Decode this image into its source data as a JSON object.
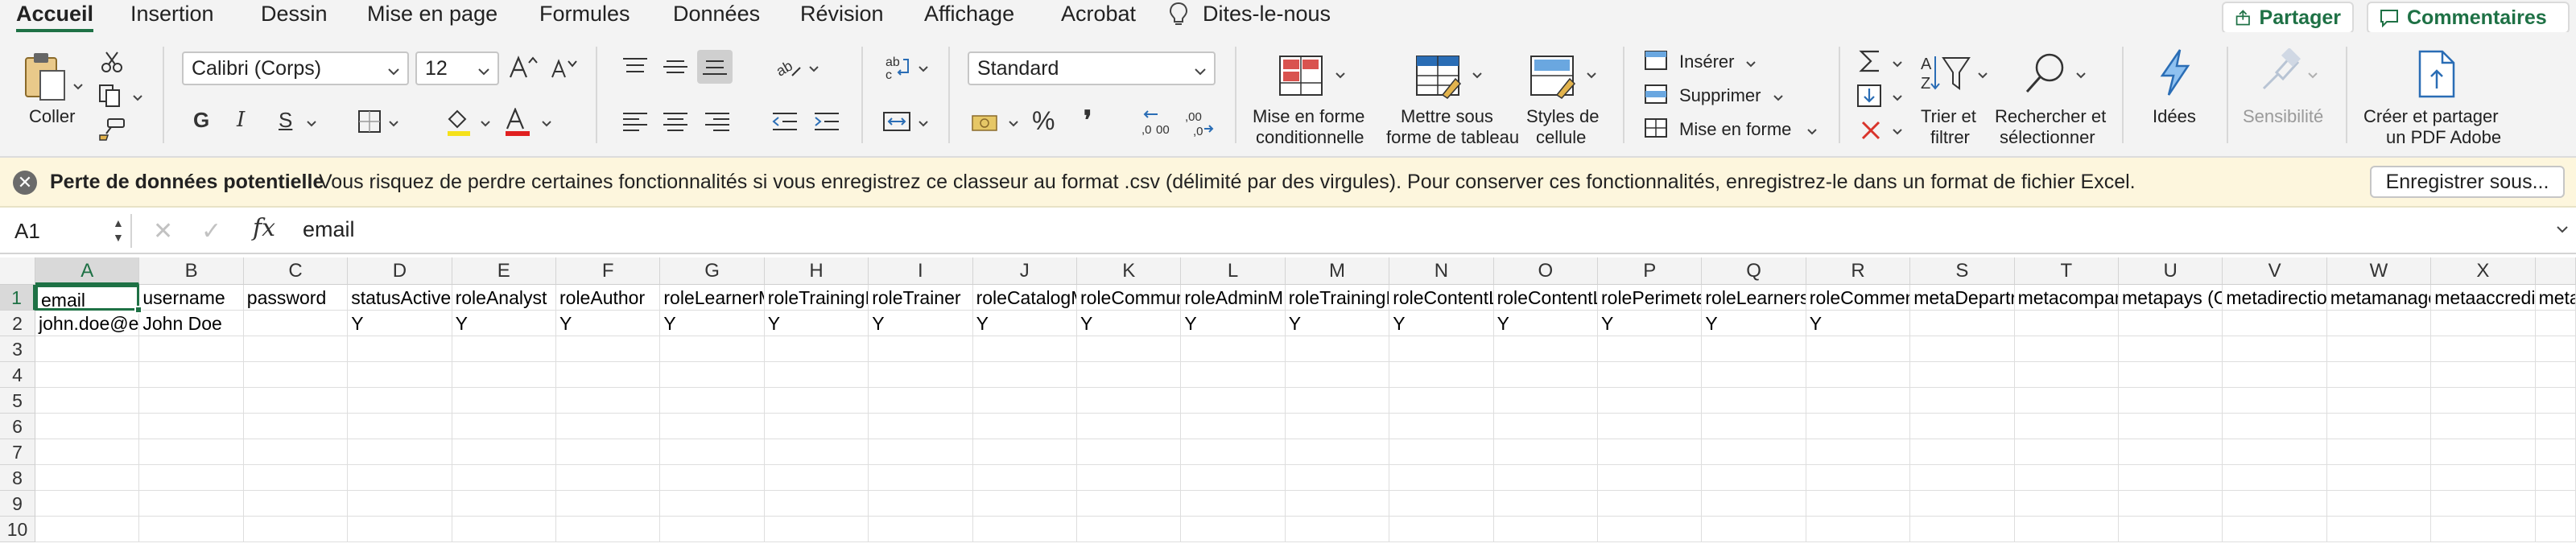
{
  "menu_tabs": [
    "Accueil",
    "Insertion",
    "Dessin",
    "Mise en page",
    "Formules",
    "Données",
    "Révision",
    "Affichage",
    "Acrobat",
    "Dites-le-nous"
  ],
  "share": {
    "label": "Partager"
  },
  "comments": {
    "label": "Commentaires"
  },
  "ribbon": {
    "paste_label": "Coller",
    "font_name": "Calibri (Corps)",
    "font_size": "12",
    "bold": "G",
    "italic": "I",
    "underline": "S",
    "number_format": "Standard",
    "percent": "%",
    "thousands": "❜",
    "cond_format_label": [
      "Mise en forme",
      "conditionnelle"
    ],
    "table_format_label": [
      "Mettre sous",
      "forme de tableau"
    ],
    "cell_styles_label": [
      "Styles de",
      "cellule"
    ],
    "insert_label": "Insérer",
    "delete_label": "Supprimer",
    "format_label": "Mise en forme",
    "sort_filter_label": [
      "Trier et",
      "filtrer"
    ],
    "find_label": [
      "Rechercher et",
      "sélectionner"
    ],
    "ideas_label": "Idées",
    "sensitivity_label": "Sensibilité",
    "pdf_label": [
      "Créer et partager",
      "un PDF Adobe"
    ],
    "accent_color": "#1e7145"
  },
  "warning": {
    "title": "Perte de données potentielle",
    "message": "Vous risquez de perdre certaines fonctionnalités si vous enregistrez ce classeur au format .csv (délimité par des virgules). Pour conserver ces fonctionnalités, enregistrez-le dans un format de fichier Excel.",
    "button": "Enregistrer sous..."
  },
  "formula_bar": {
    "cell_ref": "A1",
    "cancel": "✕",
    "confirm": "✓",
    "fx": "fx",
    "value": "email"
  },
  "sheet": {
    "columns": [
      "A",
      "B",
      "C",
      "D",
      "E",
      "F",
      "G",
      "H",
      "I",
      "J",
      "K",
      "L",
      "M",
      "N",
      "O",
      "P",
      "Q",
      "R",
      "S",
      "T",
      "U",
      "V",
      "W",
      "X"
    ],
    "rows": [
      "1",
      "2",
      "3",
      "4",
      "5",
      "6",
      "7",
      "8",
      "9",
      "10"
    ],
    "header_row": [
      "email",
      "username",
      "password",
      "statusActive",
      "roleAnalyst",
      "roleAuthor",
      "roleLearnerM",
      "roleTrainingI",
      "roleTrainer",
      "roleCatalogM",
      "roleCommun",
      "roleAdminM",
      "roleTrainingI",
      "roleContentL",
      "roleContentL",
      "rolePerimete",
      "roleLearners",
      "roleCommen",
      "metaDepartr",
      "metacompar",
      "metapays (C",
      "metadirectio",
      "metamanage",
      "metaaccredi",
      "meta"
    ],
    "data_row": [
      "john.doe@ex",
      "John Doe",
      "",
      "Y",
      "Y",
      "Y",
      "Y",
      "Y",
      "Y",
      "Y",
      "Y",
      "Y",
      "Y",
      "Y",
      "Y",
      "Y",
      "Y",
      "Y",
      "",
      "",
      "",
      "",
      "",
      ""
    ]
  }
}
